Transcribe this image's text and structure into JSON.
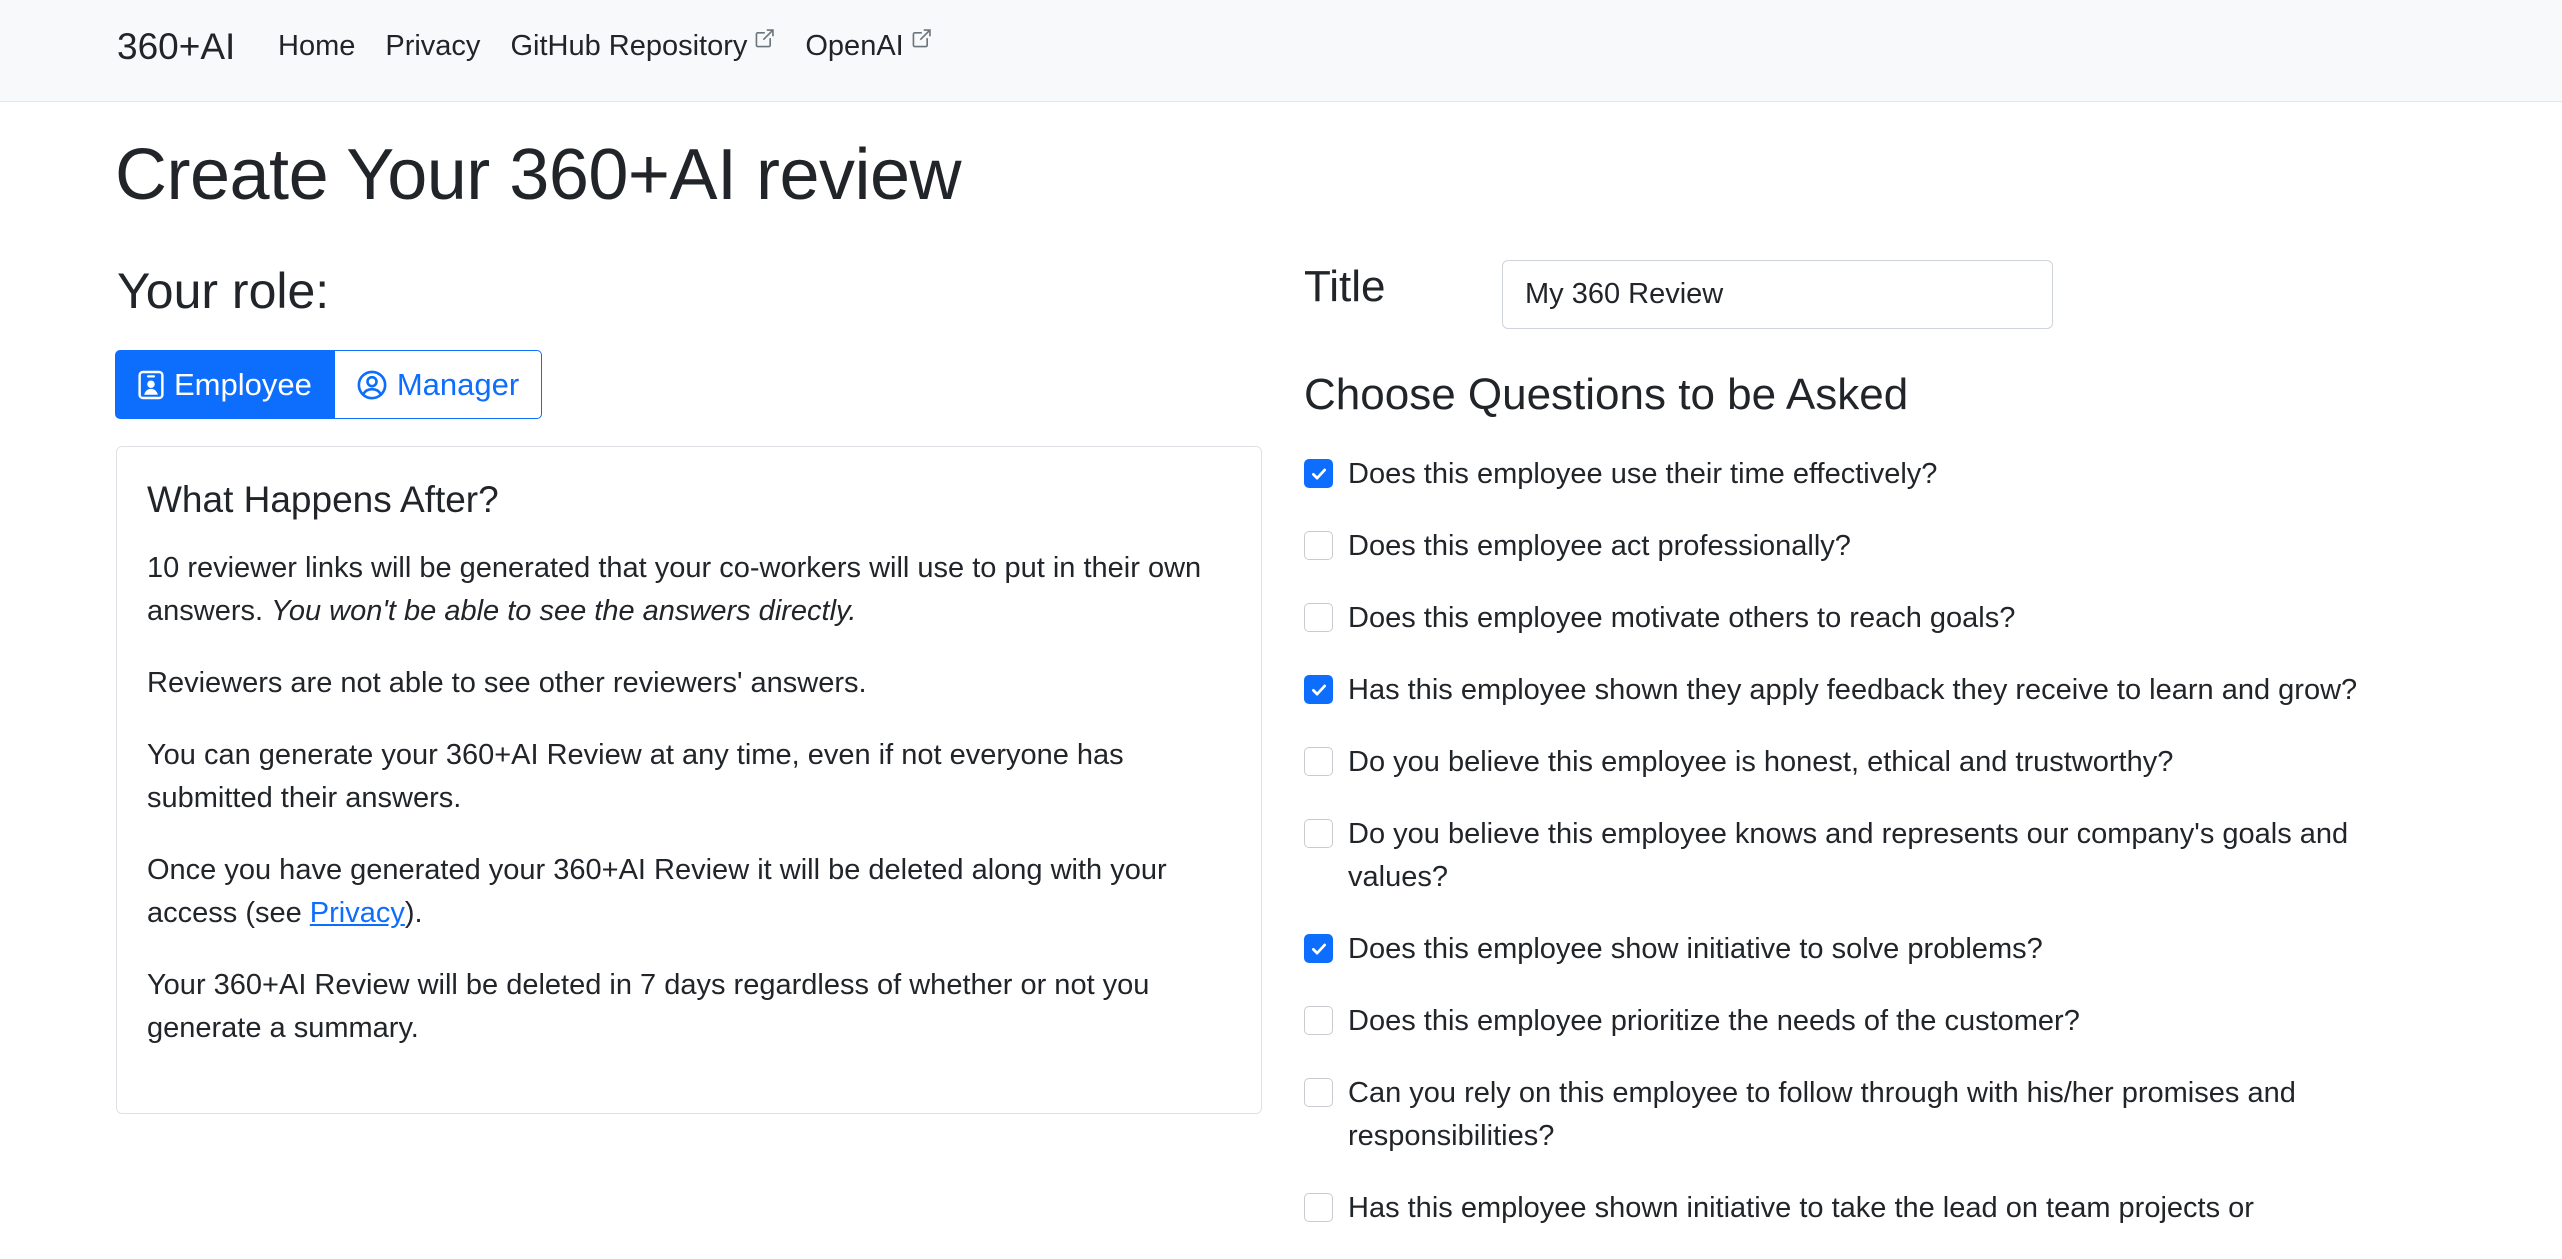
{
  "navbar": {
    "brand": "360+AI",
    "links": [
      {
        "label": "Home",
        "external": false
      },
      {
        "label": "Privacy",
        "external": false
      },
      {
        "label": "GitHub Repository",
        "external": true
      },
      {
        "label": "OpenAI",
        "external": true
      }
    ]
  },
  "page": {
    "title": "Create Your 360+AI review"
  },
  "role": {
    "heading": "Your role:",
    "options": [
      {
        "label": "Employee",
        "icon": "badge-icon",
        "selected": true
      },
      {
        "label": "Manager",
        "icon": "person-circle-icon",
        "selected": false
      }
    ]
  },
  "info_card": {
    "heading": "What Happens After?",
    "p1_text": "10 reviewer links will be generated that your co-workers will use to put in their own answers.",
    "p1_emphasis": "You won't be able to see the answers directly.",
    "p2": "Reviewers are not able to see other reviewers' answers.",
    "p3": "You can generate your 360+AI Review at any time, even if not everyone has submitted their answers.",
    "p4_before": "Once you have generated your 360+AI Review it will be deleted along with your access (see",
    "p4_link": "Privacy",
    "p4_after": ").",
    "p5": "Your 360+AI Review will be deleted in 7 days regardless of whether or not you generate a summary."
  },
  "form": {
    "title_label": "Title",
    "title_value": "My 360 Review",
    "questions_heading": "Choose Questions to be Asked",
    "questions": [
      {
        "text": "Does this employee use their time effectively?",
        "checked": true
      },
      {
        "text": "Does this employee act professionally?",
        "checked": false
      },
      {
        "text": "Does this employee motivate others to reach goals?",
        "checked": false
      },
      {
        "text": "Has this employee shown they apply feedback they receive to learn and grow?",
        "checked": true
      },
      {
        "text": "Do you believe this employee is honest, ethical and trustworthy?",
        "checked": false
      },
      {
        "text": "Do you believe this employee knows and represents our company's goals and values?",
        "checked": false
      },
      {
        "text": "Does this employee show initiative to solve problems?",
        "checked": true
      },
      {
        "text": "Does this employee prioritize the needs of the customer?",
        "checked": false
      },
      {
        "text": "Can you rely on this employee to follow through with his/her promises and responsibilities?",
        "checked": false
      },
      {
        "text": "Has this employee shown initiative to take the lead on team projects or",
        "checked": false
      }
    ]
  },
  "colors": {
    "primary": "#0d6efd",
    "navbar_bg": "#f8f9fa",
    "text": "#212529",
    "border": "#dee2e6"
  }
}
